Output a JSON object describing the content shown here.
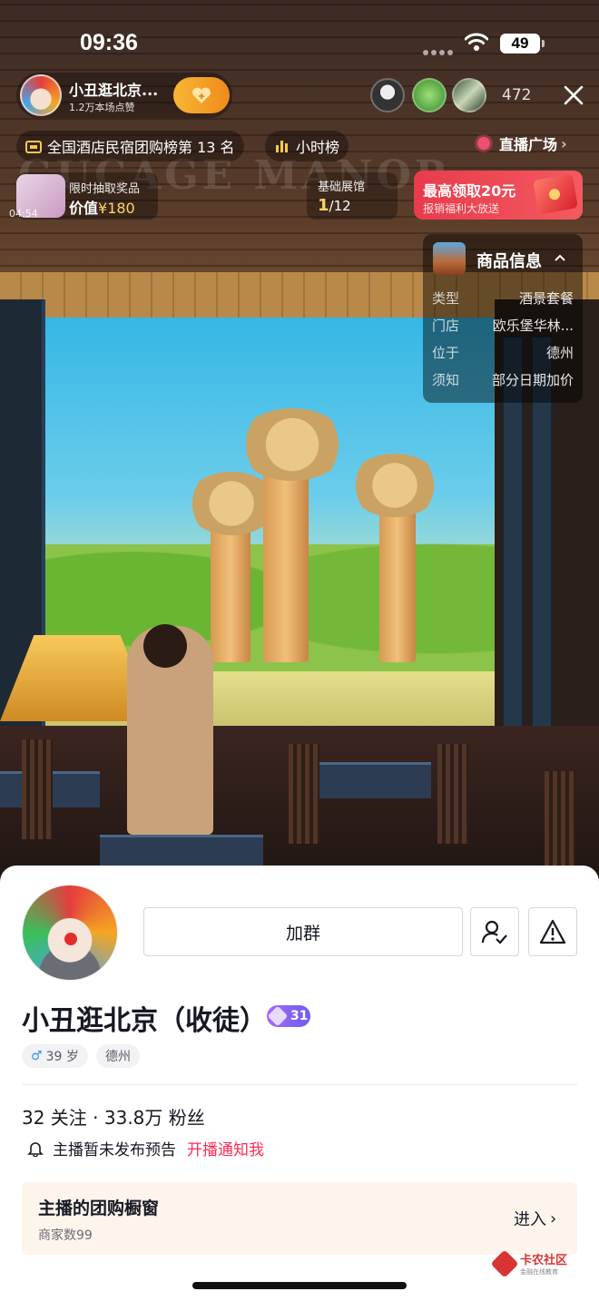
{
  "status_bar": {
    "time": "09:36",
    "battery": "49"
  },
  "host": {
    "name": "小丑逛北京...",
    "likes": "1.2万本场点赞",
    "viewer_count": "472"
  },
  "tags": {
    "ranking": "全国酒店民宿团购榜第 13 名",
    "hourly": "小时榜",
    "live_square": "直播广场"
  },
  "prize": {
    "timer": "04:54",
    "title": "限时抽取奖品",
    "value_label": "价值",
    "value_amount": "¥180"
  },
  "exhibit": {
    "title": "基础展馆",
    "current": "1",
    "total": "/12"
  },
  "red_packet": {
    "title": "最高领取20元",
    "subtitle": "报销福利大放送"
  },
  "product_info": {
    "title": "商品信息",
    "rows": [
      {
        "key": "类型",
        "value": "酒景套餐"
      },
      {
        "key": "门店",
        "value": "欧乐堡华林..."
      },
      {
        "key": "位于",
        "value": "德州"
      },
      {
        "key": "须知",
        "value": "部分日期加价"
      }
    ]
  },
  "scene_watermark": "GUCAGE MANOR",
  "profile": {
    "join_label": "加群",
    "name": "小丑逛北京（收徒）",
    "level": "31",
    "gender_age": "39 岁",
    "location": "德州",
    "stats": "32 关注 · 33.8万 粉丝",
    "notice": "主播暂未发布预告",
    "notify_link": "开播通知我"
  },
  "shop": {
    "title": "主播的团购橱窗",
    "subtitle": "商家数99",
    "enter": "进入"
  },
  "watermark": {
    "title": "卡农社区",
    "subtitle": "金融在线教育"
  },
  "colors": {
    "accent_red": "#fe2c55",
    "gold": "#f7b733",
    "level_purple": "#8b63f3"
  }
}
